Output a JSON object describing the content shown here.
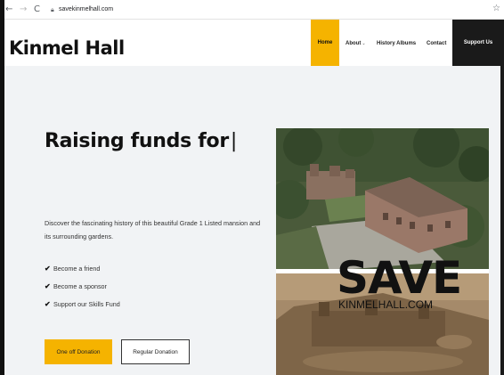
{
  "browser": {
    "back_icon": "←",
    "forward_icon": "→",
    "reload_icon": "C",
    "url": "savekinmelhall.com",
    "bookmark_icon": "☆"
  },
  "site": {
    "logo": "Kinmel Hall"
  },
  "nav": {
    "home": "Home",
    "about": "About",
    "about_chevron": "⌄",
    "albums": "History Albums",
    "contact": "Contact",
    "support": "Support Us"
  },
  "hero": {
    "title": "Raising funds for",
    "cursor": "|",
    "description": "Discover the fascinating history of this beautiful Grade 1 Listed mansion and its surrounding gardens.",
    "features": [
      "Become a friend",
      "Become a sponsor",
      "Support our Skills Fund"
    ],
    "tick": "✔",
    "primary_button": "One off Donation",
    "secondary_button": "Regular Donation"
  },
  "image": {
    "save": "SAVE",
    "domain": "KINMELHALL.COM"
  },
  "colors": {
    "accent": "#f5b300",
    "dark": "#1a1a1a",
    "background": "#f1f3f5"
  }
}
